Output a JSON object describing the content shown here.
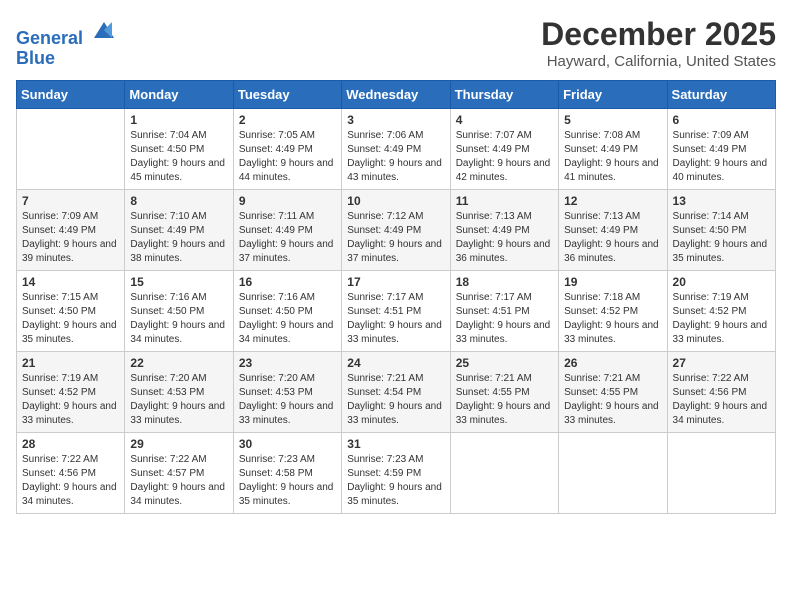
{
  "header": {
    "logo": {
      "line1": "General",
      "line2": "Blue"
    },
    "title": "December 2025",
    "location": "Hayward, California, United States"
  },
  "calendar": {
    "headers": [
      "Sunday",
      "Monday",
      "Tuesday",
      "Wednesday",
      "Thursday",
      "Friday",
      "Saturday"
    ],
    "weeks": [
      [
        {
          "day": "",
          "sunrise": "",
          "sunset": "",
          "daylight": ""
        },
        {
          "day": "1",
          "sunrise": "Sunrise: 7:04 AM",
          "sunset": "Sunset: 4:50 PM",
          "daylight": "Daylight: 9 hours and 45 minutes."
        },
        {
          "day": "2",
          "sunrise": "Sunrise: 7:05 AM",
          "sunset": "Sunset: 4:49 PM",
          "daylight": "Daylight: 9 hours and 44 minutes."
        },
        {
          "day": "3",
          "sunrise": "Sunrise: 7:06 AM",
          "sunset": "Sunset: 4:49 PM",
          "daylight": "Daylight: 9 hours and 43 minutes."
        },
        {
          "day": "4",
          "sunrise": "Sunrise: 7:07 AM",
          "sunset": "Sunset: 4:49 PM",
          "daylight": "Daylight: 9 hours and 42 minutes."
        },
        {
          "day": "5",
          "sunrise": "Sunrise: 7:08 AM",
          "sunset": "Sunset: 4:49 PM",
          "daylight": "Daylight: 9 hours and 41 minutes."
        },
        {
          "day": "6",
          "sunrise": "Sunrise: 7:09 AM",
          "sunset": "Sunset: 4:49 PM",
          "daylight": "Daylight: 9 hours and 40 minutes."
        }
      ],
      [
        {
          "day": "7",
          "sunrise": "Sunrise: 7:09 AM",
          "sunset": "Sunset: 4:49 PM",
          "daylight": "Daylight: 9 hours and 39 minutes."
        },
        {
          "day": "8",
          "sunrise": "Sunrise: 7:10 AM",
          "sunset": "Sunset: 4:49 PM",
          "daylight": "Daylight: 9 hours and 38 minutes."
        },
        {
          "day": "9",
          "sunrise": "Sunrise: 7:11 AM",
          "sunset": "Sunset: 4:49 PM",
          "daylight": "Daylight: 9 hours and 37 minutes."
        },
        {
          "day": "10",
          "sunrise": "Sunrise: 7:12 AM",
          "sunset": "Sunset: 4:49 PM",
          "daylight": "Daylight: 9 hours and 37 minutes."
        },
        {
          "day": "11",
          "sunrise": "Sunrise: 7:13 AM",
          "sunset": "Sunset: 4:49 PM",
          "daylight": "Daylight: 9 hours and 36 minutes."
        },
        {
          "day": "12",
          "sunrise": "Sunrise: 7:13 AM",
          "sunset": "Sunset: 4:49 PM",
          "daylight": "Daylight: 9 hours and 36 minutes."
        },
        {
          "day": "13",
          "sunrise": "Sunrise: 7:14 AM",
          "sunset": "Sunset: 4:50 PM",
          "daylight": "Daylight: 9 hours and 35 minutes."
        }
      ],
      [
        {
          "day": "14",
          "sunrise": "Sunrise: 7:15 AM",
          "sunset": "Sunset: 4:50 PM",
          "daylight": "Daylight: 9 hours and 35 minutes."
        },
        {
          "day": "15",
          "sunrise": "Sunrise: 7:16 AM",
          "sunset": "Sunset: 4:50 PM",
          "daylight": "Daylight: 9 hours and 34 minutes."
        },
        {
          "day": "16",
          "sunrise": "Sunrise: 7:16 AM",
          "sunset": "Sunset: 4:50 PM",
          "daylight": "Daylight: 9 hours and 34 minutes."
        },
        {
          "day": "17",
          "sunrise": "Sunrise: 7:17 AM",
          "sunset": "Sunset: 4:51 PM",
          "daylight": "Daylight: 9 hours and 33 minutes."
        },
        {
          "day": "18",
          "sunrise": "Sunrise: 7:17 AM",
          "sunset": "Sunset: 4:51 PM",
          "daylight": "Daylight: 9 hours and 33 minutes."
        },
        {
          "day": "19",
          "sunrise": "Sunrise: 7:18 AM",
          "sunset": "Sunset: 4:52 PM",
          "daylight": "Daylight: 9 hours and 33 minutes."
        },
        {
          "day": "20",
          "sunrise": "Sunrise: 7:19 AM",
          "sunset": "Sunset: 4:52 PM",
          "daylight": "Daylight: 9 hours and 33 minutes."
        }
      ],
      [
        {
          "day": "21",
          "sunrise": "Sunrise: 7:19 AM",
          "sunset": "Sunset: 4:52 PM",
          "daylight": "Daylight: 9 hours and 33 minutes."
        },
        {
          "day": "22",
          "sunrise": "Sunrise: 7:20 AM",
          "sunset": "Sunset: 4:53 PM",
          "daylight": "Daylight: 9 hours and 33 minutes."
        },
        {
          "day": "23",
          "sunrise": "Sunrise: 7:20 AM",
          "sunset": "Sunset: 4:53 PM",
          "daylight": "Daylight: 9 hours and 33 minutes."
        },
        {
          "day": "24",
          "sunrise": "Sunrise: 7:21 AM",
          "sunset": "Sunset: 4:54 PM",
          "daylight": "Daylight: 9 hours and 33 minutes."
        },
        {
          "day": "25",
          "sunrise": "Sunrise: 7:21 AM",
          "sunset": "Sunset: 4:55 PM",
          "daylight": "Daylight: 9 hours and 33 minutes."
        },
        {
          "day": "26",
          "sunrise": "Sunrise: 7:21 AM",
          "sunset": "Sunset: 4:55 PM",
          "daylight": "Daylight: 9 hours and 33 minutes."
        },
        {
          "day": "27",
          "sunrise": "Sunrise: 7:22 AM",
          "sunset": "Sunset: 4:56 PM",
          "daylight": "Daylight: 9 hours and 34 minutes."
        }
      ],
      [
        {
          "day": "28",
          "sunrise": "Sunrise: 7:22 AM",
          "sunset": "Sunset: 4:56 PM",
          "daylight": "Daylight: 9 hours and 34 minutes."
        },
        {
          "day": "29",
          "sunrise": "Sunrise: 7:22 AM",
          "sunset": "Sunset: 4:57 PM",
          "daylight": "Daylight: 9 hours and 34 minutes."
        },
        {
          "day": "30",
          "sunrise": "Sunrise: 7:23 AM",
          "sunset": "Sunset: 4:58 PM",
          "daylight": "Daylight: 9 hours and 35 minutes."
        },
        {
          "day": "31",
          "sunrise": "Sunrise: 7:23 AM",
          "sunset": "Sunset: 4:59 PM",
          "daylight": "Daylight: 9 hours and 35 minutes."
        },
        {
          "day": "",
          "sunrise": "",
          "sunset": "",
          "daylight": ""
        },
        {
          "day": "",
          "sunrise": "",
          "sunset": "",
          "daylight": ""
        },
        {
          "day": "",
          "sunrise": "",
          "sunset": "",
          "daylight": ""
        }
      ]
    ]
  }
}
